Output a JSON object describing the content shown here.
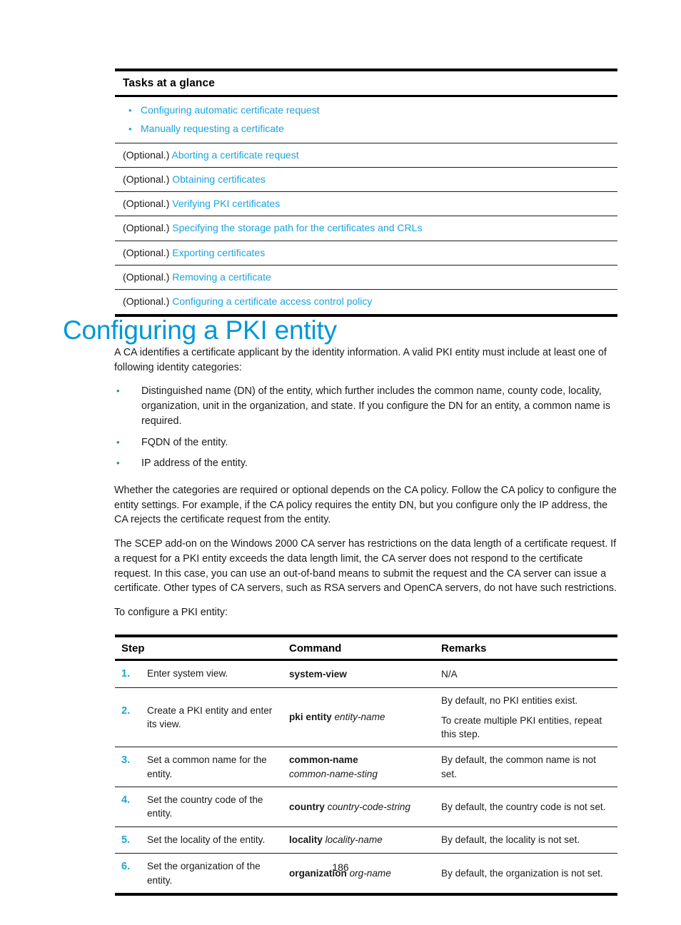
{
  "tasks_table": {
    "header": "Tasks at a glance",
    "bullet_rows": [
      {
        "bullet": "•",
        "link": "Configuring automatic certificate request"
      },
      {
        "bullet": "•",
        "link": "Manually requesting a certificate"
      }
    ],
    "optional_rows": [
      {
        "prefix": "(Optional.) ",
        "link": "Aborting a certificate request"
      },
      {
        "prefix": "(Optional.) ",
        "link": "Obtaining certificates"
      },
      {
        "prefix": "(Optional.) ",
        "link": "Verifying PKI certificates"
      },
      {
        "prefix": "(Optional.) ",
        "link": "Specifying the storage path for the certificates and CRLs"
      },
      {
        "prefix": "(Optional.) ",
        "link": "Exporting certificates"
      },
      {
        "prefix": "(Optional.) ",
        "link": "Removing a certificate"
      },
      {
        "prefix": "(Optional.) ",
        "link": "Configuring a certificate access control policy"
      }
    ]
  },
  "heading": "Configuring a PKI entity",
  "body": {
    "intro": "A CA identifies a certificate applicant by the identity information. A valid PKI entity must include at least one of following identity categories:",
    "bullets": [
      "Distinguished name (DN) of the entity, which further includes the common name, county code, locality, organization, unit in the organization, and state. If you configure the DN for an entity, a common name is required.",
      "FQDN of the entity.",
      "IP address of the entity."
    ],
    "bullet_glyph": "•",
    "para2": "Whether the categories are required or optional depends on the CA policy. Follow the CA policy to configure the entity settings. For example, if the CA policy requires the entity DN, but you configure only the IP address, the CA rejects the certificate request from the entity.",
    "para3": "The SCEP add-on on the Windows 2000 CA server has restrictions on the data length of a certificate request. If a request for a PKI entity exceeds the data length limit, the CA server does not respond to the certificate request. In this case, you can use an out-of-band means to submit the request and the CA server can issue a certificate. Other types of CA servers, such as RSA servers and OpenCA servers, do not have such restrictions.",
    "para4": "To configure a PKI entity:"
  },
  "procedure_table": {
    "columns": [
      "Step",
      "Command",
      "Remarks"
    ],
    "rows": [
      {
        "num": "1.",
        "step": "Enter system view.",
        "cmd_bold": "system-view",
        "cmd_italic": "",
        "cmd_bold2": "",
        "cmd_italic2": "",
        "remarks": [
          "N/A"
        ]
      },
      {
        "num": "2.",
        "step": "Create a PKI entity and enter its view.",
        "cmd_bold": "pki entity",
        "cmd_italic": "entity-name",
        "cmd_bold2": "",
        "cmd_italic2": "",
        "remarks": [
          "By default, no PKI entities exist.",
          "To create multiple PKI entities, repeat this step."
        ]
      },
      {
        "num": "3.",
        "step": "Set a common name for the entity.",
        "cmd_bold": "common-name",
        "cmd_italic": "",
        "cmd_bold2": "",
        "cmd_italic2": "common-name-sting",
        "remarks": [
          "By default, the common name is not set."
        ]
      },
      {
        "num": "4.",
        "step": "Set the country code of the entity.",
        "cmd_bold": "country",
        "cmd_italic": "country-code-string",
        "cmd_bold2": "",
        "cmd_italic2": "",
        "remarks": [
          "By default, the country code is not set."
        ]
      },
      {
        "num": "5.",
        "step": "Set the locality of the entity.",
        "cmd_bold": "locality",
        "cmd_italic": "locality-name",
        "cmd_bold2": "",
        "cmd_italic2": "",
        "remarks": [
          "By default, the locality is not set."
        ]
      },
      {
        "num": "6.",
        "step": "Set the organization of the entity.",
        "cmd_bold": "organization",
        "cmd_italic": "org-name",
        "cmd_bold2": "",
        "cmd_italic2": "",
        "remarks": [
          "By default, the organization is not set."
        ]
      }
    ]
  },
  "footer": {
    "page_number": "186"
  },
  "colors": {
    "link": "#1ba3de",
    "heading": "#0097d7",
    "step_number": "#1ba3de",
    "bullet": "#1f84c4",
    "text": "#1a1a1a",
    "rule": "#000000"
  }
}
